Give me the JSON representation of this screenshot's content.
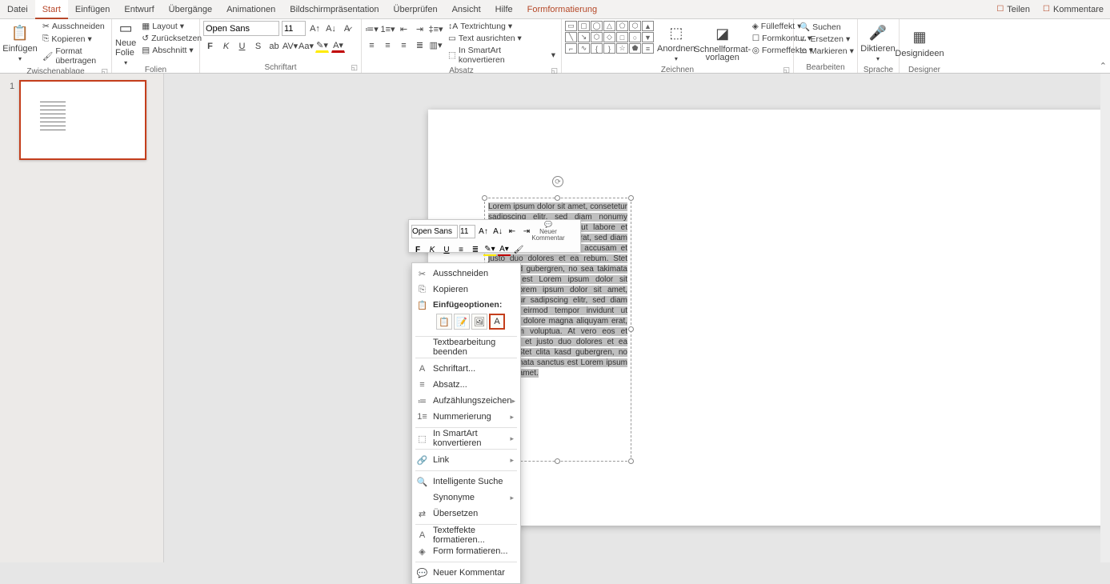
{
  "tabs": {
    "items": [
      "Datei",
      "Start",
      "Einfügen",
      "Entwurf",
      "Übergänge",
      "Animationen",
      "Bildschirmpräsentation",
      "Überprüfen",
      "Ansicht",
      "Hilfe",
      "Formformatierung"
    ],
    "active": 1,
    "context_index": 10,
    "share": "Teilen",
    "comments": "Kommentare"
  },
  "ribbon": {
    "clipboard": {
      "paste": "Einfügen",
      "cut": "Ausschneiden",
      "copy": "Kopieren",
      "format_painter": "Format übertragen",
      "label": "Zwischenablage"
    },
    "slides": {
      "new": "Neue Folie",
      "layout": "Layout",
      "reset": "Zurücksetzen",
      "section": "Abschnitt",
      "label": "Folien"
    },
    "font": {
      "name": "Open Sans",
      "size": "11",
      "label": "Schriftart"
    },
    "paragraph": {
      "direction": "Textrichtung",
      "align": "Text ausrichten",
      "smartart": "In SmartArt konvertieren",
      "label": "Absatz"
    },
    "drawing": {
      "arrange": "Anordnen",
      "quickstyles": "Schnellformat-\nvorlagen",
      "fill": "Fülleffekt",
      "outline": "Formkontur",
      "effects": "Formeffekte",
      "label": "Zeichnen"
    },
    "editing": {
      "find": "Suchen",
      "replace": "Ersetzen",
      "select": "Markieren",
      "label": "Bearbeiten"
    },
    "voice": {
      "dictate": "Diktieren",
      "label": "Sprache"
    },
    "designer": {
      "ideas": "Designideen",
      "label": "Designer"
    }
  },
  "thumb": {
    "num": "1"
  },
  "textbox_text": "Lorem ipsum dolor sit amet, consetetur sadipscing elitr, sed diam nonumy eirmod tempor invidunt ut labore et dolore magna aliquyam erat, sed diam voluptua. At vero eos et accusam et justo duo dolores et ea rebum. Stet clita kasd gubergren, no sea takimata sanctus est Lorem ipsum dolor sit amet. Lorem ipsum dolor sit amet, consetetur sadipscing elitr, sed diam nonumy eirmod tempor invidunt ut labore et dolore magna aliquyam erat, sed diam voluptua. At vero eos et accusam et justo duo dolores et ea rebum. Stet clita kasd gubergren, no sea takimata sanctus est Lorem ipsum dolor sit amet.",
  "mini_tb": {
    "font": "Open Sans",
    "size": "11",
    "new_comment": "Neuer Kommentar"
  },
  "ctx": {
    "cut": "Ausschneiden",
    "copy": "Kopieren",
    "paste_label": "Einfügeoptionen:",
    "exit_edit": "Textbearbeitung beenden",
    "font": "Schriftart...",
    "paragraph": "Absatz...",
    "bullets": "Aufzählungszeichen",
    "numbering": "Nummerierung",
    "smartart": "In SmartArt konvertieren",
    "link": "Link",
    "smart_lookup": "Intelligente Suche",
    "synonyms": "Synonyme",
    "translate": "Übersetzen",
    "text_effects": "Texteffekte formatieren...",
    "format_shape": "Form formatieren...",
    "new_comment": "Neuer Kommentar"
  }
}
